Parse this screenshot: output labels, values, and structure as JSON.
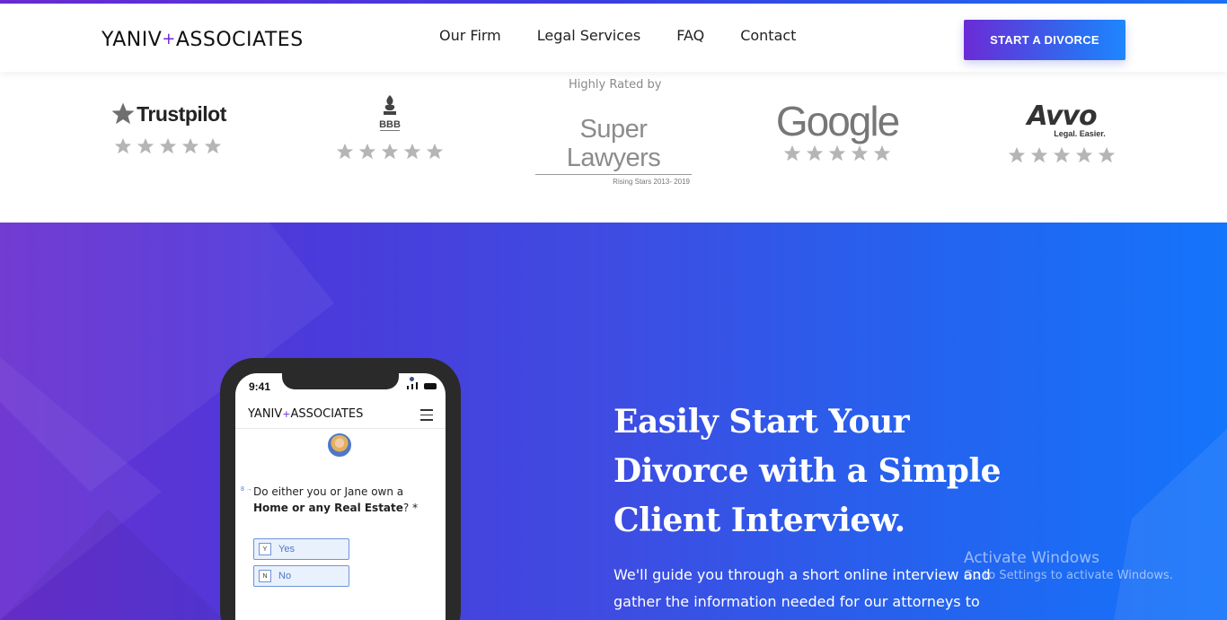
{
  "header": {
    "logo_left": "YANIV",
    "logo_plus": "+",
    "logo_right": "ASSOCIATES",
    "nav": [
      "Our Firm",
      "Legal Services",
      "FAQ",
      "Contact"
    ],
    "cta_label": "START A DIVORCE"
  },
  "ratings": {
    "heading": "Highly Rated by",
    "brands": [
      {
        "name": "Trustpilot",
        "icon": "trustpilot-star-icon",
        "stars": 5
      },
      {
        "name": "BBB",
        "icon": "bbb-torch-icon",
        "stars": 5
      },
      {
        "name": "Super Lawyers",
        "subtitle": "Rising Stars 2013- 2019"
      },
      {
        "name": "Google",
        "stars": 5
      },
      {
        "name": "Avvo",
        "subtitle": "Legal. Easier.",
        "stars": 5
      }
    ],
    "star_color": "#b5b5b5"
  },
  "phone": {
    "time": "9:41",
    "logo_left": "YANIV",
    "logo_plus": "+",
    "logo_right": "ASSOCIATES",
    "question_number": "8 →",
    "question_pre": "Do either you or Jane own a",
    "question_bold": "Home or any Real Estate",
    "question_post": "? *",
    "options": [
      {
        "key": "Y",
        "label": "Yes"
      },
      {
        "key": "N",
        "label": "No"
      }
    ]
  },
  "hero": {
    "title": "Easily Start Your Divorce with a Simple Client Interview.",
    "text": "We'll guide you through a short online interview and gather the information needed for our attorneys to"
  },
  "watermark": {
    "line1": "Activate Windows",
    "line2": "Go to Settings to activate Windows."
  },
  "colors": {
    "accent_purple": "#6b2bd6",
    "accent_blue": "#1f86ff"
  }
}
